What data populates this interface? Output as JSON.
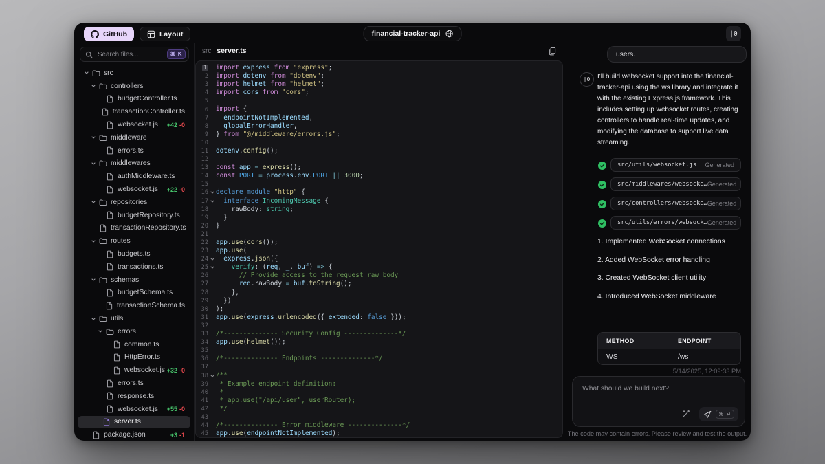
{
  "colors": {
    "accent_lavender": "#e7d5fa",
    "diff_add_green": "#46c16a",
    "diff_remove_red": "#e5484d",
    "check_green": "#2fbf63",
    "selected_file_purple": "#a184f5"
  },
  "topbar": {
    "github_label": "GitHub",
    "layout_label": "Layout",
    "project_name": "financial-tracker-api",
    "logo_glyph": "|0"
  },
  "sidebar": {
    "search_placeholder": "Search files...",
    "search_shortcut": "⌘ K",
    "tree": [
      {
        "type": "folder",
        "name": "src",
        "depth": 0,
        "expanded": true
      },
      {
        "type": "folder",
        "name": "controllers",
        "depth": 1,
        "expanded": true
      },
      {
        "type": "file",
        "name": "budgetController.ts",
        "depth": 2
      },
      {
        "type": "file",
        "name": "transactionController.ts",
        "depth": 2
      },
      {
        "type": "file",
        "name": "websocket.js",
        "depth": 2,
        "added": "+42",
        "removed": "-0"
      },
      {
        "type": "folder",
        "name": "middleware",
        "depth": 1,
        "expanded": true
      },
      {
        "type": "file",
        "name": "errors.ts",
        "depth": 2
      },
      {
        "type": "folder",
        "name": "middlewares",
        "depth": 1,
        "expanded": true
      },
      {
        "type": "file",
        "name": "authMiddleware.ts",
        "depth": 2
      },
      {
        "type": "file",
        "name": "websocket.js",
        "depth": 2,
        "added": "+22",
        "removed": "-0"
      },
      {
        "type": "folder",
        "name": "repositories",
        "depth": 1,
        "expanded": true
      },
      {
        "type": "file",
        "name": "budgetRepository.ts",
        "depth": 2
      },
      {
        "type": "file",
        "name": "transactionRepository.ts",
        "depth": 2
      },
      {
        "type": "folder",
        "name": "routes",
        "depth": 1,
        "expanded": true
      },
      {
        "type": "file",
        "name": "budgets.ts",
        "depth": 2
      },
      {
        "type": "file",
        "name": "transactions.ts",
        "depth": 2
      },
      {
        "type": "folder",
        "name": "schemas",
        "depth": 1,
        "expanded": true
      },
      {
        "type": "file",
        "name": "budgetSchema.ts",
        "depth": 2
      },
      {
        "type": "file",
        "name": "transactionSchema.ts",
        "depth": 2
      },
      {
        "type": "folder",
        "name": "utils",
        "depth": 1,
        "expanded": true
      },
      {
        "type": "folder",
        "name": "errors",
        "depth": 2,
        "expanded": true
      },
      {
        "type": "file",
        "name": "common.ts",
        "depth": 3
      },
      {
        "type": "file",
        "name": "HttpError.ts",
        "depth": 3
      },
      {
        "type": "file",
        "name": "websocket.js",
        "depth": 3,
        "added": "+32",
        "removed": "-0"
      },
      {
        "type": "file",
        "name": "errors.ts",
        "depth": 2
      },
      {
        "type": "file",
        "name": "response.ts",
        "depth": 2
      },
      {
        "type": "file",
        "name": "websocket.js",
        "depth": 2,
        "added": "+55",
        "removed": "-0"
      },
      {
        "type": "file",
        "name": "server.ts",
        "depth": 1,
        "selected": true
      },
      {
        "type": "file",
        "name": "package.json",
        "depth": 0,
        "added": "+3",
        "removed": "-1"
      }
    ]
  },
  "editor": {
    "breadcrumb": "src",
    "filename": "server.ts",
    "fold_lines": [
      16,
      17,
      24,
      25,
      38
    ],
    "lines": [
      [
        [
          "kw",
          "import "
        ],
        [
          "id",
          "express"
        ],
        [
          "kw",
          " from "
        ],
        [
          "str",
          "\"express\""
        ],
        [
          "pln",
          ";"
        ]
      ],
      [
        [
          "kw",
          "import "
        ],
        [
          "id",
          "dotenv"
        ],
        [
          "kw",
          " from "
        ],
        [
          "str",
          "\"dotenv\""
        ],
        [
          "pln",
          ";"
        ]
      ],
      [
        [
          "kw",
          "import "
        ],
        [
          "id",
          "helmet"
        ],
        [
          "kw",
          " from "
        ],
        [
          "str",
          "\"helmet\""
        ],
        [
          "pln",
          ";"
        ]
      ],
      [
        [
          "kw",
          "import "
        ],
        [
          "id",
          "cors"
        ],
        [
          "kw",
          " from "
        ],
        [
          "str",
          "\"cors\""
        ],
        [
          "pln",
          ";"
        ]
      ],
      [],
      [
        [
          "kw",
          "import "
        ],
        [
          "pln",
          "{"
        ]
      ],
      [
        [
          "pln",
          "  "
        ],
        [
          "id",
          "endpointNotImplemented"
        ],
        [
          "pln",
          ","
        ]
      ],
      [
        [
          "pln",
          "  "
        ],
        [
          "id",
          "globalErrorHandler"
        ],
        [
          "pln",
          ","
        ]
      ],
      [
        [
          "pln",
          "} "
        ],
        [
          "kw",
          "from "
        ],
        [
          "str",
          "\"@/middleware/errors.js\""
        ],
        [
          "pln",
          ";"
        ]
      ],
      [],
      [
        [
          "id",
          "dotenv"
        ],
        [
          "pln",
          "."
        ],
        [
          "fn",
          "config"
        ],
        [
          "pln",
          "();"
        ]
      ],
      [],
      [
        [
          "kw",
          "const "
        ],
        [
          "id",
          "app"
        ],
        [
          "op",
          " = "
        ],
        [
          "fn",
          "express"
        ],
        [
          "pln",
          "();"
        ]
      ],
      [
        [
          "kw",
          "const "
        ],
        [
          "cst",
          "PORT"
        ],
        [
          "op",
          " = "
        ],
        [
          "id",
          "process"
        ],
        [
          "pln",
          "."
        ],
        [
          "id",
          "env"
        ],
        [
          "pln",
          "."
        ],
        [
          "cst",
          "PORT"
        ],
        [
          "op",
          " || "
        ],
        [
          "num",
          "3000"
        ],
        [
          "pln",
          ";"
        ]
      ],
      [],
      [
        [
          "bkw",
          "declare module "
        ],
        [
          "str",
          "\"http\""
        ],
        [
          "pln",
          " {"
        ]
      ],
      [
        [
          "pln",
          "  "
        ],
        [
          "bkw",
          "interface "
        ],
        [
          "type",
          "IncomingMessage"
        ],
        [
          "pln",
          " {"
        ]
      ],
      [
        [
          "pln",
          "    rawBody"
        ],
        [
          "pln",
          ": "
        ],
        [
          "type",
          "string"
        ],
        [
          "pln",
          ";"
        ]
      ],
      [
        [
          "pln",
          "  }"
        ]
      ],
      [
        [
          "pln",
          "}"
        ]
      ],
      [],
      [
        [
          "id",
          "app"
        ],
        [
          "pln",
          "."
        ],
        [
          "fn",
          "use"
        ],
        [
          "pln",
          "("
        ],
        [
          "fn",
          "cors"
        ],
        [
          "pln",
          "());"
        ]
      ],
      [
        [
          "id",
          "app"
        ],
        [
          "pln",
          "."
        ],
        [
          "fn",
          "use"
        ],
        [
          "pln",
          "("
        ]
      ],
      [
        [
          "pln",
          "  "
        ],
        [
          "id",
          "express"
        ],
        [
          "pln",
          "."
        ],
        [
          "fn",
          "json"
        ],
        [
          "pln",
          "({"
        ]
      ],
      [
        [
          "pln",
          "    "
        ],
        [
          "prop",
          "verify"
        ],
        [
          "pln",
          ": ("
        ],
        [
          "id",
          "req"
        ],
        [
          "pln",
          ", "
        ],
        [
          "id",
          "_"
        ],
        [
          "pln",
          ", "
        ],
        [
          "id",
          "buf"
        ],
        [
          "pln",
          ") "
        ],
        [
          "op",
          "=>"
        ],
        [
          "pln",
          " {"
        ]
      ],
      [
        [
          "pln",
          "      "
        ],
        [
          "com",
          "// Provide access to the request raw body"
        ]
      ],
      [
        [
          "pln",
          "      "
        ],
        [
          "id",
          "req"
        ],
        [
          "pln",
          ".rawBody"
        ],
        [
          "op",
          " = "
        ],
        [
          "id",
          "buf"
        ],
        [
          "pln",
          "."
        ],
        [
          "fn",
          "toString"
        ],
        [
          "pln",
          "();"
        ]
      ],
      [
        [
          "pln",
          "    },"
        ]
      ],
      [
        [
          "pln",
          "  })"
        ]
      ],
      [
        [
          "pln",
          ");"
        ]
      ],
      [
        [
          "id",
          "app"
        ],
        [
          "pln",
          "."
        ],
        [
          "fn",
          "use"
        ],
        [
          "pln",
          "("
        ],
        [
          "id",
          "express"
        ],
        [
          "pln",
          "."
        ],
        [
          "fn",
          "urlencoded"
        ],
        [
          "pln",
          "({ "
        ],
        [
          "id",
          "extended"
        ],
        [
          "pln",
          ": "
        ],
        [
          "bool",
          "false"
        ],
        [
          "pln",
          " }));"
        ]
      ],
      [],
      [
        [
          "com",
          "/*-------------- Security Config --------------*/"
        ]
      ],
      [
        [
          "id",
          "app"
        ],
        [
          "pln",
          "."
        ],
        [
          "fn",
          "use"
        ],
        [
          "pln",
          "("
        ],
        [
          "fn",
          "helmet"
        ],
        [
          "pln",
          "());"
        ]
      ],
      [],
      [
        [
          "com",
          "/*-------------- Endpoints --------------*/"
        ]
      ],
      [],
      [
        [
          "com",
          "/**"
        ]
      ],
      [
        [
          "com",
          " * Example endpoint definition:"
        ]
      ],
      [
        [
          "com",
          " *"
        ]
      ],
      [
        [
          "com",
          " * app.use(\"/api/user\", userRouter);"
        ]
      ],
      [
        [
          "com",
          " */"
        ]
      ],
      [],
      [
        [
          "com",
          "/*-------------- Error middleware --------------*/"
        ]
      ],
      [
        [
          "id",
          "app"
        ],
        [
          "pln",
          "."
        ],
        [
          "fn",
          "use"
        ],
        [
          "pln",
          "("
        ],
        [
          "id",
          "endpointNotImplemented"
        ],
        [
          "pln",
          ");"
        ]
      ]
    ]
  },
  "chat": {
    "prev_message_tail": "users.",
    "avatar_glyph": "|0",
    "intro": "I'll build websocket support into the financial-tracker-api using the ws library and integrate it with the existing Express.js framework. This includes setting up websocket routes, creating controllers to handle real-time updates, and modifying the database to support live data streaming.",
    "generated_files": [
      {
        "path": "src/utils/websocket.js",
        "status": "Generated"
      },
      {
        "path": "src/middlewares/websocke…",
        "status": "Generated"
      },
      {
        "path": "src/controllers/websocke…",
        "status": "Generated"
      },
      {
        "path": "src/utils/errors/websock…",
        "status": "Generated"
      }
    ],
    "steps": [
      "1. Implemented WebSocket connections",
      "2. Added WebSocket error handling",
      "3. Created WebSocket client utility",
      "4. Introduced WebSocket middleware"
    ],
    "table": {
      "headers": [
        "METHOD",
        "ENDPOINT"
      ],
      "rows": [
        [
          "WS",
          "/ws"
        ]
      ]
    },
    "timestamp": "5/14/2025, 12:09:33 PM",
    "input_placeholder": "What should we build next?",
    "send_shortcut": "⌘ ↵",
    "disclaimer": "The code may contain errors. Please review and test the output."
  }
}
